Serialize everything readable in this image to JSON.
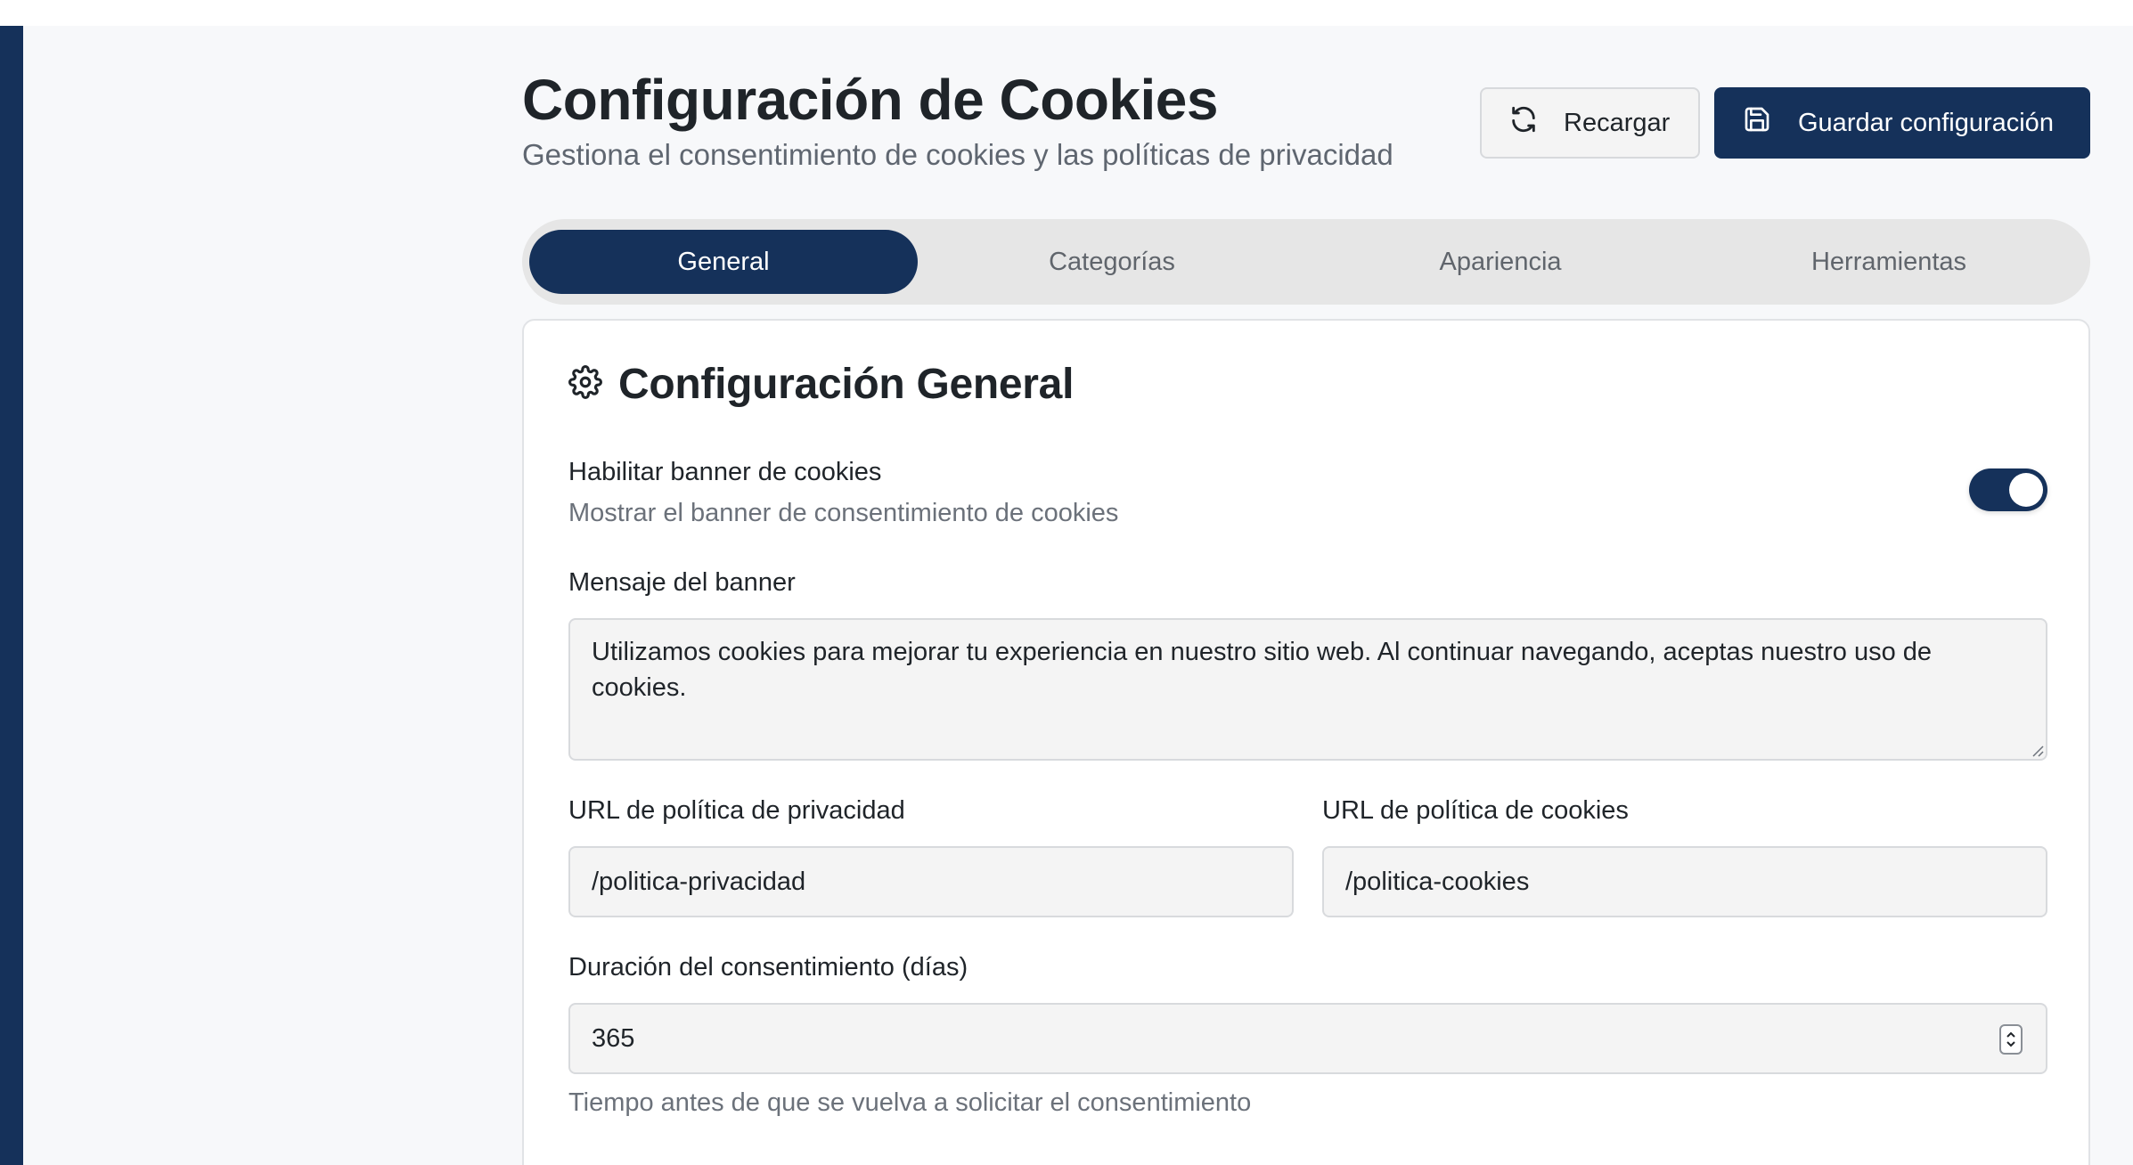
{
  "header": {
    "title": "Configuración de Cookies",
    "subtitle": "Gestiona el consentimiento de cookies y las políticas de privacidad",
    "reload_label": "Recargar",
    "save_label": "Guardar configuración"
  },
  "tabs": [
    {
      "label": "General",
      "active": true
    },
    {
      "label": "Categorías",
      "active": false
    },
    {
      "label": "Apariencia",
      "active": false
    },
    {
      "label": "Herramientas",
      "active": false
    }
  ],
  "general": {
    "section_title": "Configuración General",
    "section_icon": "gear-icon",
    "banner_toggle": {
      "label": "Habilitar banner de cookies",
      "description": "Mostrar el banner de consentimiento de cookies",
      "enabled": true
    },
    "banner_message": {
      "label": "Mensaje del banner",
      "value": "Utilizamos cookies para mejorar tu experiencia en nuestro sitio web. Al continuar navegando, aceptas nuestro uso de cookies."
    },
    "privacy_url": {
      "label": "URL de política de privacidad",
      "value": "/politica-privacidad"
    },
    "cookies_url": {
      "label": "URL de política de cookies",
      "value": "/politica-cookies"
    },
    "consent_duration": {
      "label": "Duración del consentimiento (días)",
      "value": "365",
      "help": "Tiempo antes de que se vuelva a solicitar el consentimiento"
    }
  },
  "colors": {
    "primary": "#15315a",
    "background": "#f7f8fa",
    "tab_track": "#e6e6e6",
    "input_bg": "#f4f4f4"
  }
}
